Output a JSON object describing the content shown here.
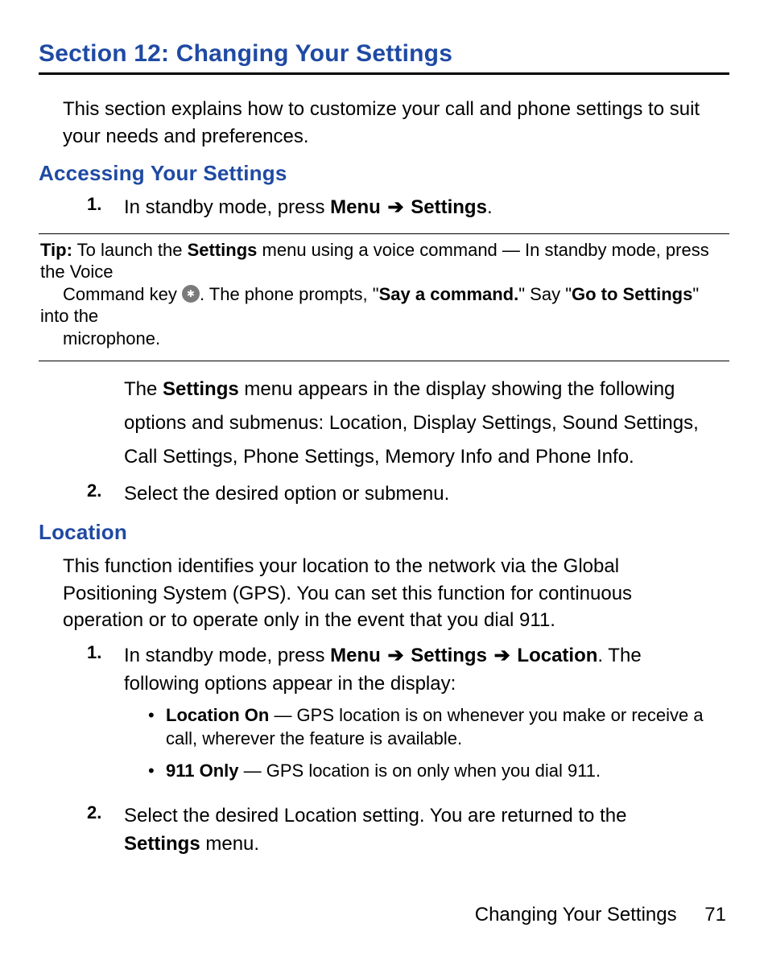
{
  "section_title": "Section 12: Changing Your Settings",
  "intro": "This section explains how to customize your call and phone settings to suit your needs and preferences.",
  "access": {
    "heading": "Accessing Your Settings",
    "step1": {
      "marker": "1.",
      "pre": "In standby mode, press ",
      "b1": "Menu",
      "arrow": "➔",
      "b2": "Settings",
      "post": "."
    },
    "tip": {
      "label": "Tip:",
      "t1": " To launch the ",
      "b1": "Settings",
      "t2": " menu using a voice command — In standby mode, press the Voice ",
      "line2a": "Command key ",
      "icon_label": "voice-command-key-icon",
      "line2b": ". The phone prompts, \"",
      "b2": "Say a command.",
      "line2c": "\" Say \"",
      "b3": "Go to Settings",
      "line2d": "\" into the ",
      "line3": "microphone."
    },
    "para": {
      "t1": "The ",
      "b1": "Settings",
      "t2": " menu appears in the display showing the following options and submenus: Location, Display Settings, Sound Settings, Call Settings, Phone Settings, Memory Info and Phone Info."
    },
    "step2": {
      "marker": "2.",
      "text": "Select the desired option or submenu."
    }
  },
  "location": {
    "heading": "Location",
    "intro": "This function identifies your location to the network via the Global Positioning System (GPS). You can set this function for continuous operation or to operate only in the event that you dial 911.",
    "step1": {
      "marker": "1.",
      "pre": "In standby mode, press ",
      "b1": "Menu",
      "arrow": "➔",
      "b2": "Settings",
      "b3": "Location",
      "post1": ". The following options appear in the display:"
    },
    "bullets": [
      {
        "b": "Location On",
        "t": " — GPS location is on whenever you make or receive a call, wherever the feature is available."
      },
      {
        "b": "911 Only",
        "t": " — GPS location is on only when you dial 911."
      }
    ],
    "step2": {
      "marker": "2.",
      "t1": "Select the desired Location setting. You are returned to the ",
      "b1": "Settings",
      "t2": " menu."
    }
  },
  "footer": {
    "title": "Changing Your Settings",
    "page": "71"
  }
}
